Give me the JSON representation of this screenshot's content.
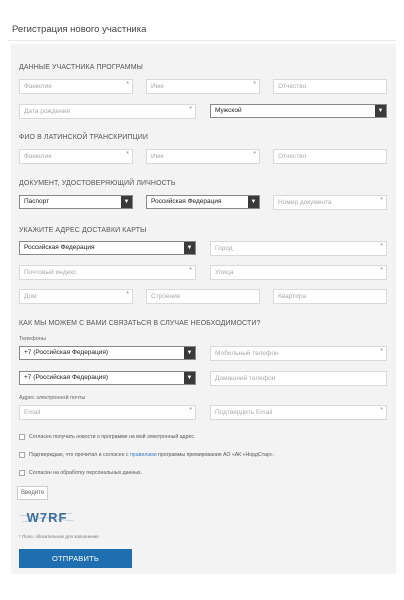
{
  "page_title": "Регистрация нового участника",
  "sections": {
    "participant": "ДАННЫЕ УЧАСТНИКА ПРОГРАММЫ",
    "latin": "ФИО В ЛАТИНСКОЙ ТРАНСКРИПЦИИ",
    "document": "ДОКУМЕНТ, УДОСТОВЕРЯЮЩИЙ ЛИЧНОСТЬ",
    "address": "УКАЖИТЕ АДРЕС ДОСТАВКИ КАРТЫ",
    "contact": "КАК МЫ МОЖЕМ С ВАМИ СВЯЗАТЬСЯ В СЛУЧАЕ НЕОБХОДИМОСТИ?"
  },
  "participant": {
    "last_name_placeholder": "Фамилия",
    "first_name_placeholder": "Имя",
    "middle_name_placeholder": "Отчество",
    "birth_date_placeholder": "Дата рождения",
    "gender_value": "Мужской"
  },
  "latin": {
    "last_name_placeholder": "Фамилия",
    "first_name_placeholder": "Имя",
    "middle_name_placeholder": "Отчество"
  },
  "document": {
    "type_value": "Паспорт",
    "country_value": "Российская Федерация",
    "number_placeholder": "Номер документа"
  },
  "address": {
    "country_value": "Российская Федерация",
    "city_placeholder": "Город",
    "postal_placeholder": "Почтовый индекс",
    "street_placeholder": "Улица",
    "house_placeholder": "Дом",
    "building_placeholder": "Строение",
    "apartment_placeholder": "Квартира"
  },
  "contact": {
    "phones_label": "Телефоны",
    "mobile_code_value": "+7 (Российская Федерация)",
    "mobile_placeholder": "Мобильный телефон",
    "home_code_value": "+7 (Российская Федерация)",
    "home_placeholder": "Домашний телефон",
    "email_label": "Адрес электронной почты",
    "email_placeholder": "Email",
    "email_confirm_placeholder": "Подтвердить Email"
  },
  "consents": {
    "news": "Согласен получать новости о программе на мой электронный адрес.",
    "rules_before": "Подтверждаю, что прочитал и согласен с ",
    "rules_link": "правилами",
    "rules_after": " программы премирования АО «АК «НордСтар».",
    "personal_data": "Согласен на обработку персональных данных."
  },
  "captcha": {
    "input_placeholder": "Введите",
    "code": "W7RF"
  },
  "required_note": "* Поле, обязательное для заполнения",
  "required_mark": "*",
  "submit_label": "ОТПРАВИТЬ"
}
